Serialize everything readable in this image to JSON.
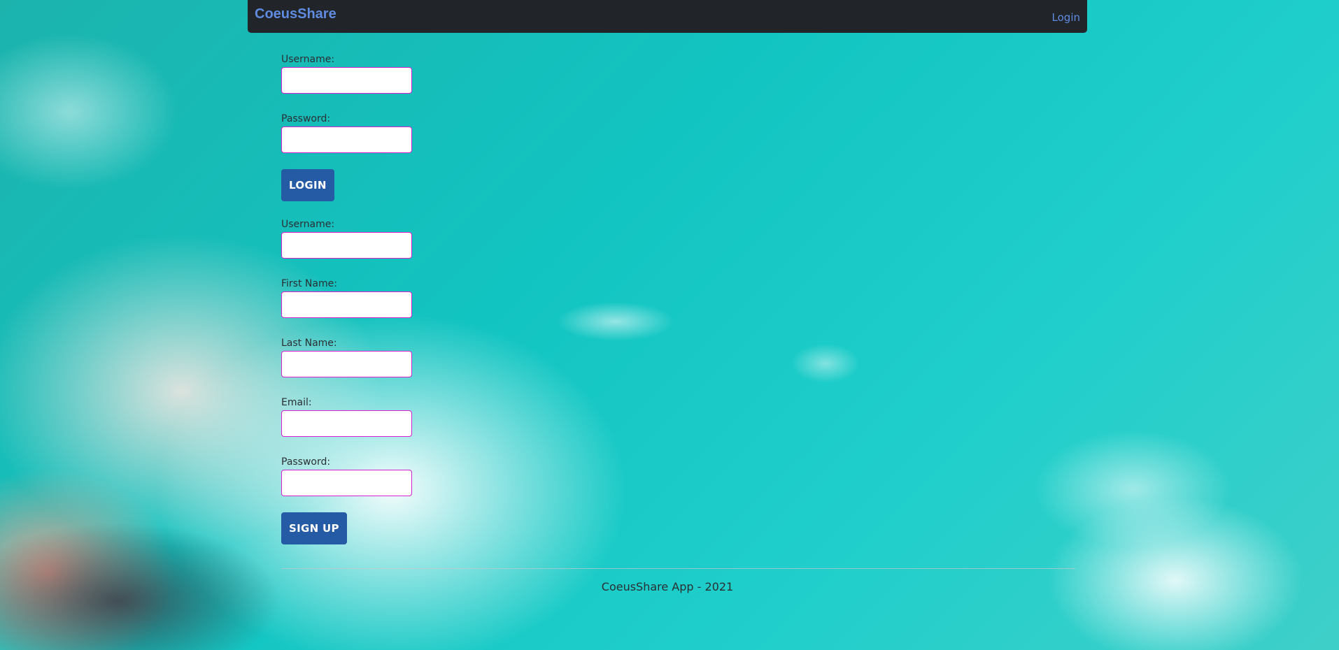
{
  "navbar": {
    "brand": "CoeusShare",
    "login_link": "Login"
  },
  "login_form": {
    "username_label": "Username:",
    "username_value": "",
    "password_label": "Password:",
    "password_value": "",
    "submit_label": "LOGIN"
  },
  "signup_form": {
    "username_label": "Username:",
    "username_value": "",
    "first_name_label": "First Name:",
    "first_name_value": "",
    "last_name_label": "Last Name:",
    "last_name_value": "",
    "email_label": "Email:",
    "email_value": "",
    "password_label": "Password:",
    "password_value": "",
    "submit_label": "SIGN UP"
  },
  "footer": {
    "text": "CoeusShare App - 2021"
  },
  "colors": {
    "navbar_bg": "#212429",
    "brand": "#5f8ce0",
    "button_bg": "#255aa4",
    "input_border": "#d321d3",
    "sky": "#12c4c1"
  }
}
